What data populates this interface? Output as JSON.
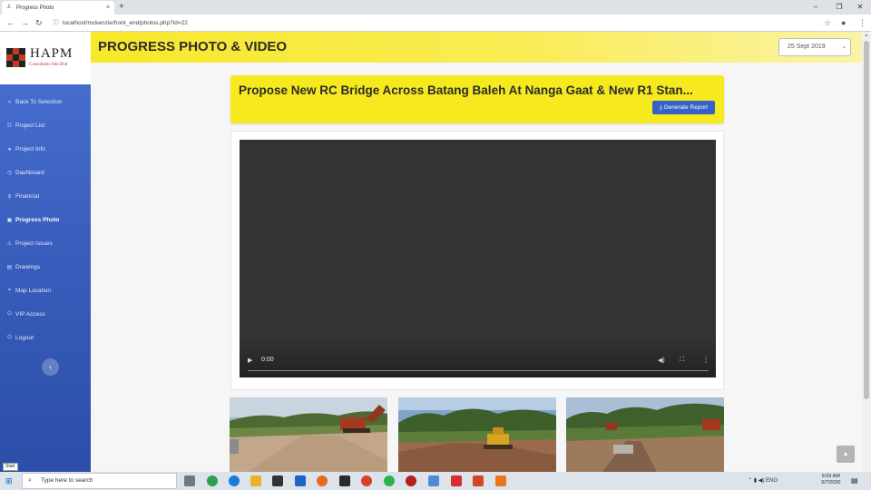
{
  "browser": {
    "tab_title": "Progress Photo",
    "tab_close": "×",
    "new_tab": "+",
    "url": "localhost/mckenzie/front_end/photos.php?id=22",
    "window_buttons": [
      "–",
      "❐",
      "✕"
    ]
  },
  "sidebar": {
    "logo_text": "HAPM",
    "logo_subtitle": "Consultants Sdn Bhd",
    "items": [
      {
        "icon": "«",
        "label": "Back To Selection"
      },
      {
        "icon": "☷",
        "label": "Project List"
      },
      {
        "icon": "●",
        "label": "Project Info"
      },
      {
        "icon": "◷",
        "label": "Dashboard"
      },
      {
        "icon": "$",
        "label": "Financial"
      },
      {
        "icon": "▣",
        "label": "Progress Photo"
      },
      {
        "icon": "⚠",
        "label": "Project Issues"
      },
      {
        "icon": "▤",
        "label": "Drawings"
      },
      {
        "icon": "⌖",
        "label": "Map Location"
      },
      {
        "icon": "⏻",
        "label": "VIP Access"
      },
      {
        "icon": "⏻",
        "label": "Logout"
      }
    ],
    "active_item": "Progress Photo",
    "collapse_icon": "‹",
    "start_tooltip": "Start"
  },
  "header": {
    "title": "PROGRESS PHOTO & VIDEO",
    "date_selected": "25 Sept 2019",
    "date_chevron": "⌄"
  },
  "project": {
    "title": "Propose New RC Bridge Across Batang Baleh At Nanga Gaat & New R1 Stan...",
    "report_button": "Generate Report",
    "report_icon": "⤓"
  },
  "video": {
    "time": "0:00",
    "play_icon": "▶",
    "volume_icon": "◀)",
    "fullscreen_icon": "⛶",
    "more_icon": "⋮",
    "progress": 0
  },
  "photos": [
    {
      "subject": "excavator-on-dirt-road"
    },
    {
      "subject": "bulldozer-on-cleared-land"
    },
    {
      "subject": "culvert-and-excavator"
    }
  ],
  "back_to_top_icon": "▲",
  "taskbar": {
    "search_placeholder": "Type here to search",
    "tray_lang": "ENG",
    "time": "9:03 AM",
    "date": "3/7/2020"
  },
  "colors": {
    "sidebar_top": "#4a71d2",
    "sidebar_bottom": "#2c4ea9",
    "header_yellow": "#f7e82a",
    "card_yellow": "#f6ea1e",
    "button_blue": "#3462c9",
    "video_bg": "#333333"
  }
}
